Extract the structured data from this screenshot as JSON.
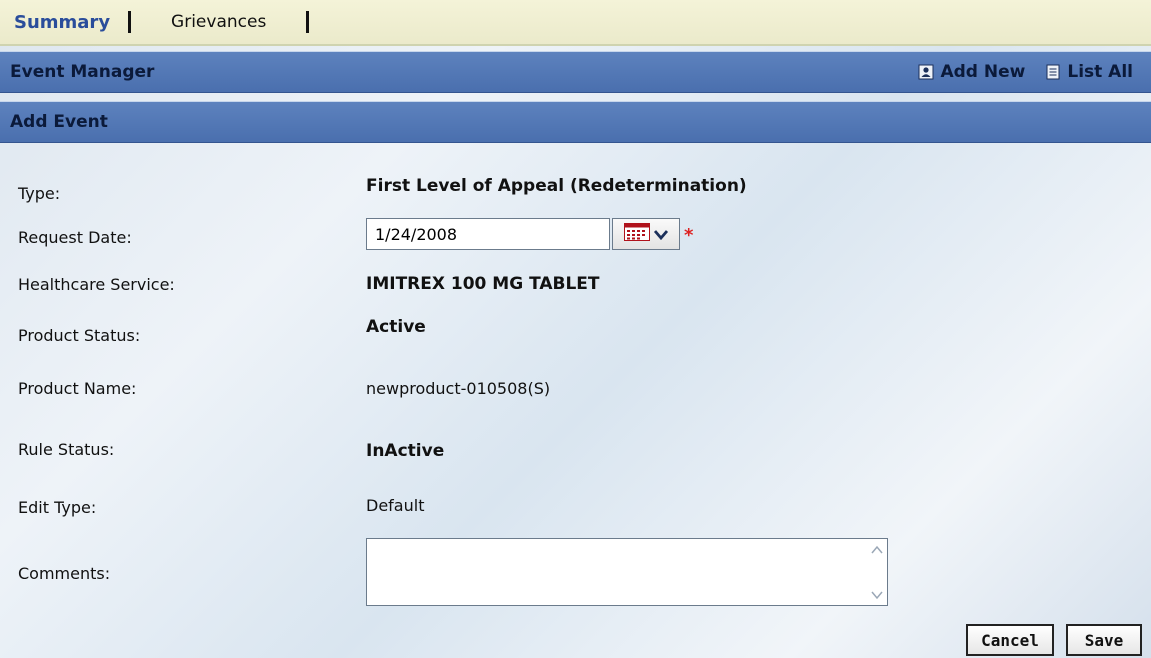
{
  "tabs": [
    {
      "label": "Summary"
    },
    {
      "label": "Grievances"
    }
  ],
  "event_manager": {
    "title": "Event Manager",
    "add_new": "Add New",
    "list_all": "List All"
  },
  "add_event": {
    "title": "Add Event"
  },
  "form": {
    "type_label": "Type:",
    "type_value": "First Level of Appeal (Redetermination)",
    "request_date_label": "Request  Date:",
    "request_date_value": "1/24/2008",
    "healthcare_label": "Healthcare Service:",
    "healthcare_value": "IMITREX 100 MG TABLET",
    "product_status_label": "Product Status:",
    "product_status_value": "Active",
    "product_name_label": "Product Name:",
    "product_name_value": "newproduct-010508(S)",
    "rule_status_label": "Rule Status:",
    "rule_status_value": "InActive",
    "edit_type_label": "Edit Type:",
    "edit_type_value": "Default",
    "comments_label": "Comments:",
    "comments_value": "",
    "required_marker": "*"
  },
  "buttons": {
    "cancel": "Cancel",
    "save": "Save"
  },
  "icons": {
    "add_new": "add-user-icon",
    "list_all": "list-icon",
    "calendar": "calendar-icon",
    "dropdown": "chevron-down-icon"
  },
  "colors": {
    "header_bar": "#4a6fae",
    "tab_bar": "#ebeacb",
    "active_tab": "#2a4d9b",
    "required": "#dd2222"
  }
}
